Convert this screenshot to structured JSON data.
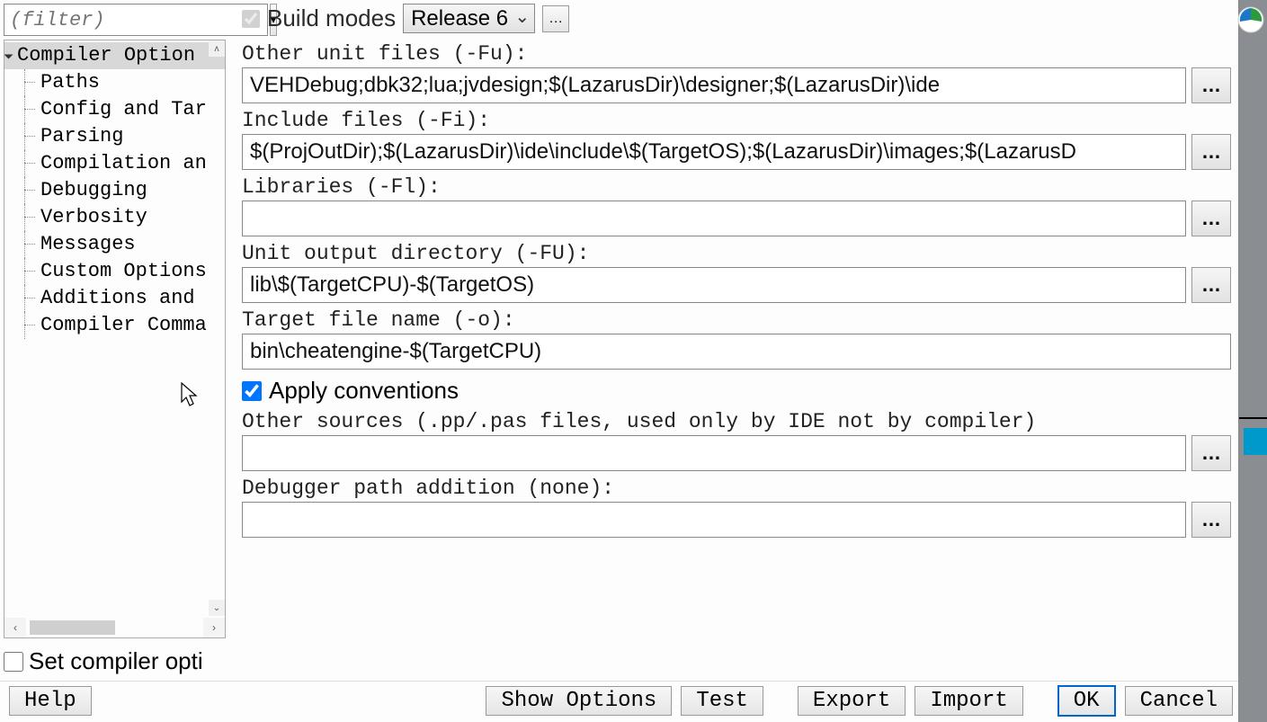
{
  "filter": {
    "placeholder": "(filter)"
  },
  "tree": {
    "root": "Compiler Option",
    "items": [
      "Paths",
      "Config and Tar",
      "Parsing",
      "Compilation an",
      "Debugging",
      "Verbosity",
      "Messages",
      "Custom Options",
      "Additions and",
      "Compiler Comma"
    ]
  },
  "buildmodes": {
    "label": "Build modes",
    "selected": "Release 6",
    "ellipsis": "…"
  },
  "fields": {
    "other_unit": {
      "label": "Other unit files (-Fu):",
      "value": "VEHDebug;dbk32;lua;jvdesign;$(LazarusDir)\\designer;$(LazarusDir)\\ide"
    },
    "include": {
      "label": "Include files (-Fi):",
      "value": "$(ProjOutDir);$(LazarusDir)\\ide\\include\\$(TargetOS);$(LazarusDir)\\images;$(LazarusD"
    },
    "libraries": {
      "label": "Libraries (-Fl):",
      "value": ""
    },
    "unit_out": {
      "label": "Unit output directory (-FU):",
      "value": "lib\\$(TargetCPU)-$(TargetOS)"
    },
    "target_file": {
      "label": "Target file name (-o):",
      "value": "bin\\cheatengine-$(TargetCPU)"
    },
    "apply_conventions": {
      "label": "Apply conventions",
      "checked": true
    },
    "other_sources": {
      "label": "Other sources (.pp/.pas files, used only by IDE not by compiler)",
      "value": ""
    },
    "debugger_path": {
      "label": "Debugger path addition (none):",
      "value": ""
    }
  },
  "set_opts": {
    "label": "Set compiler opti"
  },
  "footer": {
    "help": "Help",
    "show_options": "Show Options",
    "test": "Test",
    "export": "Export",
    "import": "Import",
    "ok": "OK",
    "cancel": "Cancel"
  },
  "browse_label": "…"
}
